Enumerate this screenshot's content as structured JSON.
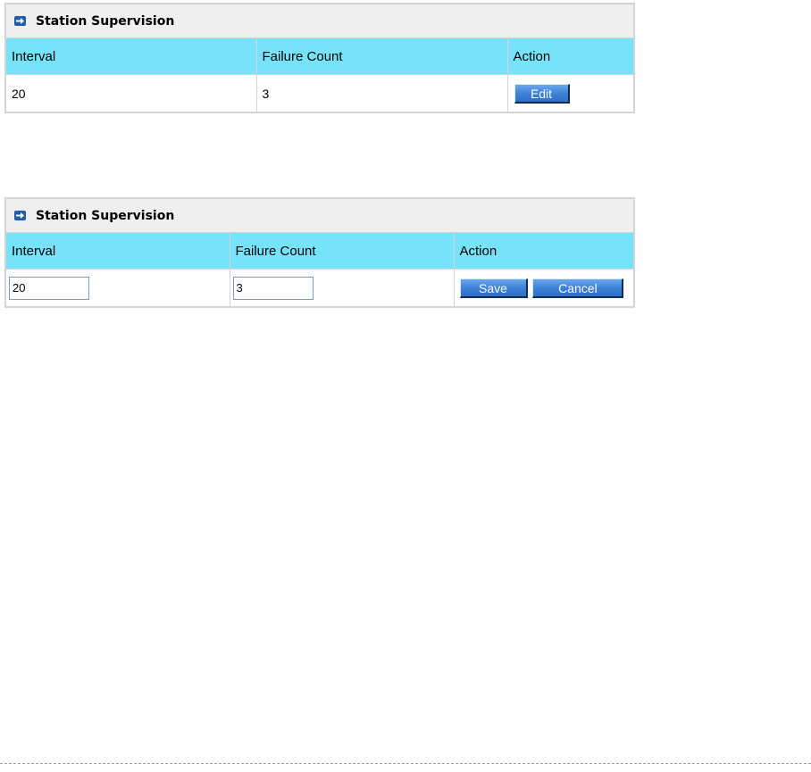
{
  "view_panel": {
    "title": "Station Supervision",
    "columns": [
      "Interval",
      "Failure Count",
      "Action"
    ],
    "row": {
      "interval": "20",
      "failure_count": "3",
      "edit_label": "Edit"
    }
  },
  "edit_panel": {
    "title": "Station Supervision",
    "columns": [
      "Interval",
      "Failure Count",
      "Action"
    ],
    "row": {
      "interval_value": "20",
      "failure_count_value": "3",
      "save_label": "Save",
      "cancel_label": "Cancel"
    }
  },
  "icons": {
    "header_icon": "arrow-right-icon"
  },
  "colors": {
    "header_bg": "#efefef",
    "column_header_bg": "#77e3fb",
    "border": "#d4d4d4",
    "button_blue": "#3b7fd6",
    "icon_blue": "#1f5fa8"
  }
}
